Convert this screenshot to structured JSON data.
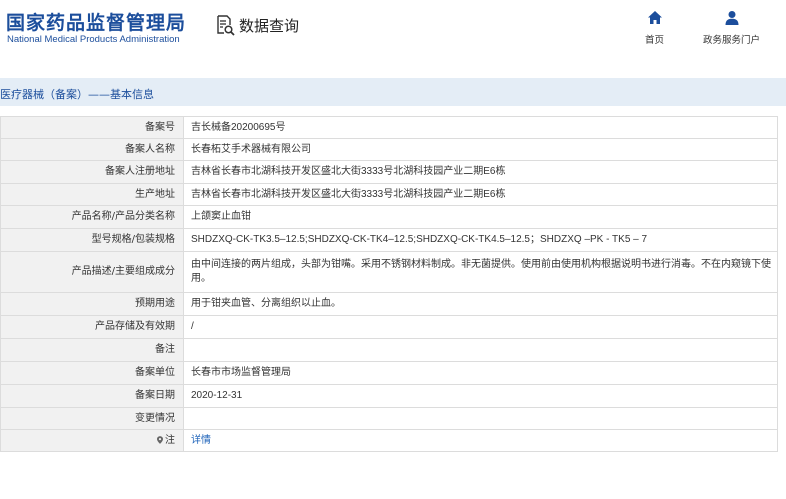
{
  "header": {
    "logo_cn": "国家药品监督管理局",
    "logo_en": "National Medical Products Administration",
    "query_label": "数据查询",
    "nav": [
      {
        "label": "首页",
        "icon": "home-icon"
      },
      {
        "label": "政务服务门户",
        "icon": "user-icon"
      }
    ]
  },
  "breadcrumb": "医疗器械（备案）——基本信息",
  "colors": {
    "brand": "#1c4e9c",
    "breadcrumb_bg": "#e4edf6",
    "label_bg": "#f1f1f1",
    "link": "#1c62b9"
  },
  "rows": [
    {
      "label": "备案号",
      "value": "吉长械备20200695号"
    },
    {
      "label": "备案人名称",
      "value": "长春柘艾手术器械有限公司"
    },
    {
      "label": "备案人注册地址",
      "value": "吉林省长春市北湖科技开发区盛北大街3333号北湖科技园产业二期E6栋"
    },
    {
      "label": "生产地址",
      "value": "吉林省长春市北湖科技开发区盛北大街3333号北湖科技园产业二期E6栋"
    },
    {
      "label": "产品名称/产品分类名称",
      "value": "上颌窦止血钳"
    },
    {
      "label": "型号规格/包装规格",
      "value": "SHDZXQ-CK-TK3.5–12.5;SHDZXQ-CK-TK4–12.5;SHDZXQ-CK-TK4.5–12.5；SHDZXQ –PK - TK5 – 7"
    },
    {
      "label": "产品描述/主要组成成分",
      "value": "由中间连接的两片组成，头部为钳嘴。采用不锈钢材料制成。非无菌提供。使用前由使用机构根据说明书进行消毒。不在内窥镜下使用。"
    },
    {
      "label": "预期用途",
      "value": "用于钳夹血管、分离组织以止血。"
    },
    {
      "label": "产品存储及有效期",
      "value": "/"
    },
    {
      "label": "备注",
      "value": ""
    },
    {
      "label": "备案单位",
      "value": "长春市市场监督管理局"
    },
    {
      "label": "备案日期",
      "value": "2020-12-31"
    },
    {
      "label": "变更情况",
      "value": ""
    },
    {
      "label": "注",
      "value": "详情"
    }
  ]
}
